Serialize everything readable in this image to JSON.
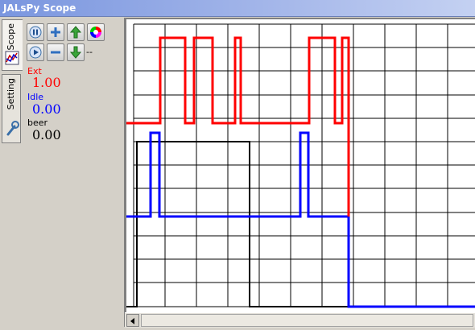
{
  "window": {
    "title": "JALsPy Scope"
  },
  "tabs": [
    {
      "label": "Scope",
      "active": true,
      "icon": "chart-icon"
    },
    {
      "label": "Setting",
      "active": false,
      "icon": "wrench-icon"
    }
  ],
  "toolbar": {
    "pause": "pause-icon",
    "zoom_in": "plus-icon",
    "up": "arrow-up-icon",
    "color": "color-wheel-icon",
    "play": "play-icon",
    "zoom_out": "minus-icon",
    "down": "arrow-down-icon",
    "extra": "--"
  },
  "channels": [
    {
      "name": "Ext",
      "value": "1.00",
      "color": "#ff0000"
    },
    {
      "name": "Idle",
      "value": "0.00",
      "color": "#0000ff"
    },
    {
      "name": "beer",
      "value": "0.00",
      "color": "#000000"
    }
  ],
  "colors": {
    "grid": "#000000",
    "background": "#ffffff"
  }
}
